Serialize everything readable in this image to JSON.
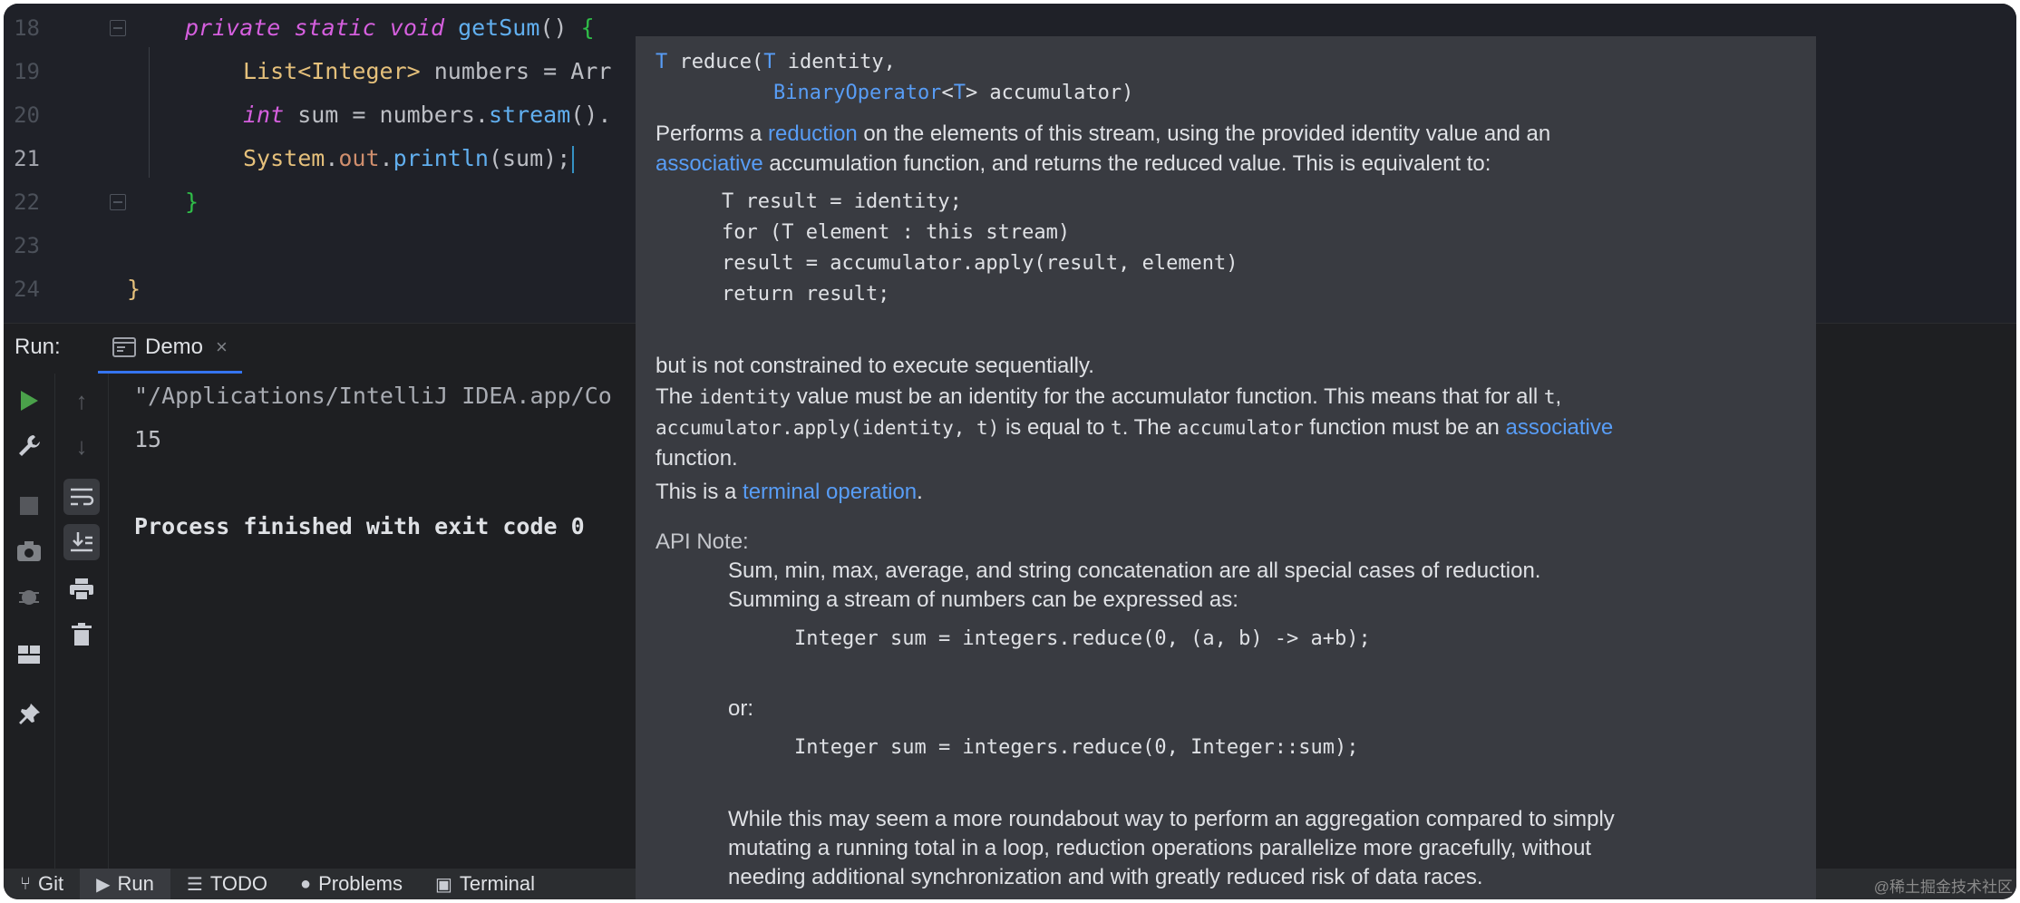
{
  "editor": {
    "line_numbers": [
      "18",
      "19",
      "20",
      "21",
      "22",
      "23",
      "24"
    ],
    "line18": {
      "kw1": "private",
      "kw2": "static",
      "kw3": "void",
      "method": "getSum",
      "rest": "()",
      "brace": "{"
    },
    "line19": {
      "type": "List<Integer>",
      "rest": " numbers = Arr"
    },
    "line20": {
      "kw": "int",
      "mid": " sum = numbers.",
      "call": "stream",
      "rest": "()."
    },
    "line21": {
      "cls": "System",
      "dot1": ".",
      "field": "out",
      "dot2": ".",
      "call": "println",
      "rest": "(sum);"
    },
    "line22": {
      "brace": "}"
    },
    "line24": {
      "brace": "}"
    }
  },
  "run": {
    "label": "Run:",
    "tab_label": "Demo",
    "tab_close": "×"
  },
  "console": {
    "line1": "\"/Applications/IntelliJ IDEA.app/Co",
    "line2": "15",
    "line3": "Process finished with exit code 0"
  },
  "bottom_bar": {
    "git": "Git",
    "run": "Run",
    "todo": "TODO",
    "problems": "Problems",
    "terminal": "Terminal"
  },
  "doc": {
    "sig_t": "T",
    "sig_reduce": " reduce(",
    "sig_t2": "T",
    "sig_identity": " identity,",
    "sig_binop": "BinaryOperator",
    "sig_lt": "<",
    "sig_t3": "T",
    "sig_gt": ">",
    "sig_acc": " accumulator)",
    "p1_a": "Performs a ",
    "p1_link1": "reduction",
    "p1_b": " on the elements of this stream, using the provided identity value and an",
    "p1_link2": "associative",
    "p1_c": " accumulation function, and returns the reduced value. This is equivalent to:",
    "code1": [
      "T result = identity;",
      "for (T element : this stream)",
      "    result = accumulator.apply(result, element)",
      "return result;"
    ],
    "p2": "but is not constrained to execute sequentially.",
    "p3_a": "The ",
    "p3_identity": "identity",
    "p3_b": " value must be an identity for the accumulator function. This means that for all ",
    "p3_t": "t",
    "p3_c": ",",
    "p4_apply": "accumulator.apply(identity, t)",
    "p4_a": " is equal to ",
    "p4_t": "t",
    "p4_b": ". The ",
    "p4_acc": "accumulator",
    "p4_c": " function must be an ",
    "p4_link": "associative",
    "p5": "function.",
    "p6_a": "This is a ",
    "p6_link": "terminal operation",
    "p6_b": ".",
    "api_note": "API Note:",
    "api1": "Sum, min, max, average, and string concatenation are all special cases of reduction.",
    "api2": "Summing a stream of numbers can be expressed as:",
    "code2": "Integer sum = integers.reduce(0, (a, b) -> a+b);",
    "or": "or:",
    "code3": "Integer sum = integers.reduce(0, Integer::sum);",
    "p7": "While this may seem a more roundabout way to perform an aggregation compared to simply",
    "p8": "mutating a running total in a loop, reduction operations parallelize more gracefully, without",
    "p9": "needing additional synchronization and with greatly reduced risk of data races."
  },
  "watermark": "@稀土掘金技术社区",
  "colors": {
    "link": "#589df6",
    "accent": "#3574f0",
    "run_green": "#4aa14a"
  }
}
